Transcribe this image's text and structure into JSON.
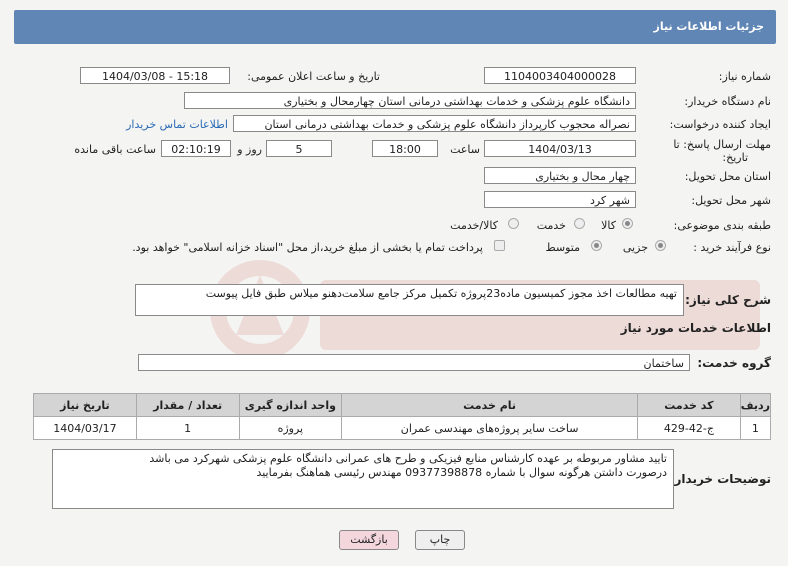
{
  "header": {
    "title": "جزئیات اطلاعات نیاز"
  },
  "fields": {
    "need_number_label": "شماره نیاز:",
    "need_number": "1104003404000028",
    "announce_label": "تاریخ و ساعت اعلان عمومی:",
    "announce_value": "1404/03/08 - 15:18",
    "buyer_label": "نام دستگاه خریدار:",
    "buyer_value": "دانشگاه علوم پزشکی و خدمات بهداشتی درمانی استان چهارمحال و بختیاری",
    "creator_label": "ایجاد کننده درخواست:",
    "creator_value": "نصراله محجوب کارپرداز دانشگاه علوم پزشکی و خدمات بهداشتی درمانی استان",
    "contact_link": "اطلاعات تماس خریدار",
    "deadline_label_1": "مهلت ارسال پاسخ: تا",
    "deadline_label_2": "تاریخ:",
    "deadline_date": "1404/03/13",
    "time_label": "ساعت",
    "deadline_time": "18:00",
    "days_value": "5",
    "days_label": "روز و",
    "remaining_time": "02:10:19",
    "remaining_label": "ساعت باقی مانده",
    "province_label": "استان محل تحویل:",
    "province_value": "چهار محال و بختیاری",
    "city_label": "شهر محل تحویل:",
    "city_value": "شهر کرد",
    "category_label": "طبقه بندی موضوعی:",
    "category_options": [
      "کالا",
      "خدمت",
      "کالا/خدمت"
    ],
    "process_label": "نوع فرآیند خرید :",
    "process_options": [
      "جزیی",
      "متوسط"
    ],
    "payment_note": "پرداخت تمام یا بخشی از مبلغ خرید،از محل \"اسناد خزانه اسلامی\" خواهد بود."
  },
  "summary": {
    "label": "شرح کلی نیاز:",
    "text": "تهیه مطالعات اخذ مجوز کمیسیون ماده23پروژه تکمیل مرکز جامع سلامت‌دهنو میلاس طبق فایل پیوست"
  },
  "services": {
    "heading": "اطلاعات خدمات مورد نیاز",
    "group_label": "گروه خدمت:",
    "group_value": "ساختمان",
    "columns": [
      "ردیف",
      "کد خدمت",
      "نام خدمت",
      "واحد اندازه گیری",
      "تعداد / مقدار",
      "تاریخ نیاز"
    ],
    "rows": [
      [
        "1",
        "ج-42-429",
        "ساخت سایر پروژه‌های مهندسی عمران",
        "پروژه",
        "1",
        "1404/03/17"
      ]
    ]
  },
  "buyer_notes": {
    "label": "توضیحات خریدار:",
    "line1": "تایید مشاور مربوطه بر عهده کارشناس منابع فیزیکی و طرح های عمرانی دانشگاه علوم پزشکی شهرکرد می باشد",
    "line2": "درصورت داشتن هرگونه سوال با شماره 09377398878 مهندس رئیسی هماهنگ بفرمایید"
  },
  "buttons": {
    "print": "چاپ",
    "back": "بازگشت"
  },
  "colors": {
    "header": "#5f86b5",
    "link": "#2a6bb5",
    "back_button": "#f3d7dc",
    "watermark": "#c0392b"
  }
}
